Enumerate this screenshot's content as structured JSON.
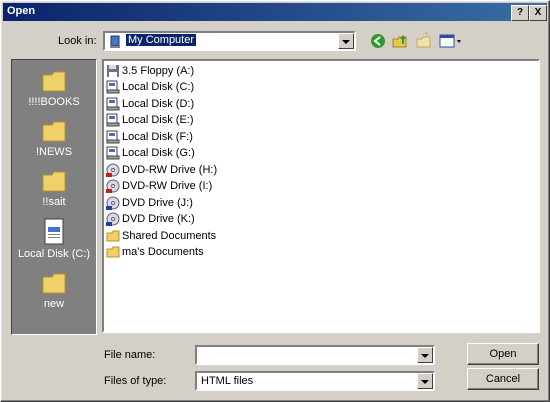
{
  "window": {
    "title": "Open",
    "help_btn": "?",
    "close_btn": "X"
  },
  "lookin": {
    "label": "Look in:",
    "value": "My Computer"
  },
  "places": [
    {
      "label": "!!!!BOOKS",
      "icon": "folder-icon"
    },
    {
      "label": "!NEWS",
      "icon": "folder-icon"
    },
    {
      "label": "!!sait",
      "icon": "folder-icon"
    },
    {
      "label": "Local Disk (C:)",
      "icon": "document-icon"
    },
    {
      "label": "new",
      "icon": "folder-icon"
    }
  ],
  "files": [
    {
      "label": "3.5 Floppy (A:)",
      "icon": "floppy-icon"
    },
    {
      "label": "Local Disk (C:)",
      "icon": "drive-icon"
    },
    {
      "label": "Local Disk (D:)",
      "icon": "drive-icon"
    },
    {
      "label": "Local Disk (E:)",
      "icon": "drive-icon"
    },
    {
      "label": "Local Disk (F:)",
      "icon": "drive-icon"
    },
    {
      "label": "Local Disk (G:)",
      "icon": "drive-icon"
    },
    {
      "label": "DVD-RW Drive (H:)",
      "icon": "dvd-icon"
    },
    {
      "label": "DVD-RW Drive (I:)",
      "icon": "dvd-icon"
    },
    {
      "label": "DVD Drive (J:)",
      "icon": "dvd-icon"
    },
    {
      "label": "DVD Drive (K:)",
      "icon": "dvd-icon"
    },
    {
      "label": "Shared Documents",
      "icon": "folder-icon"
    },
    {
      "label": "ma's Documents",
      "icon": "folder-icon"
    }
  ],
  "filename": {
    "label": "File name:",
    "value": ""
  },
  "filetype": {
    "label": "Files of type:",
    "value": "HTML files"
  },
  "buttons": {
    "open": "Open",
    "cancel": "Cancel"
  }
}
